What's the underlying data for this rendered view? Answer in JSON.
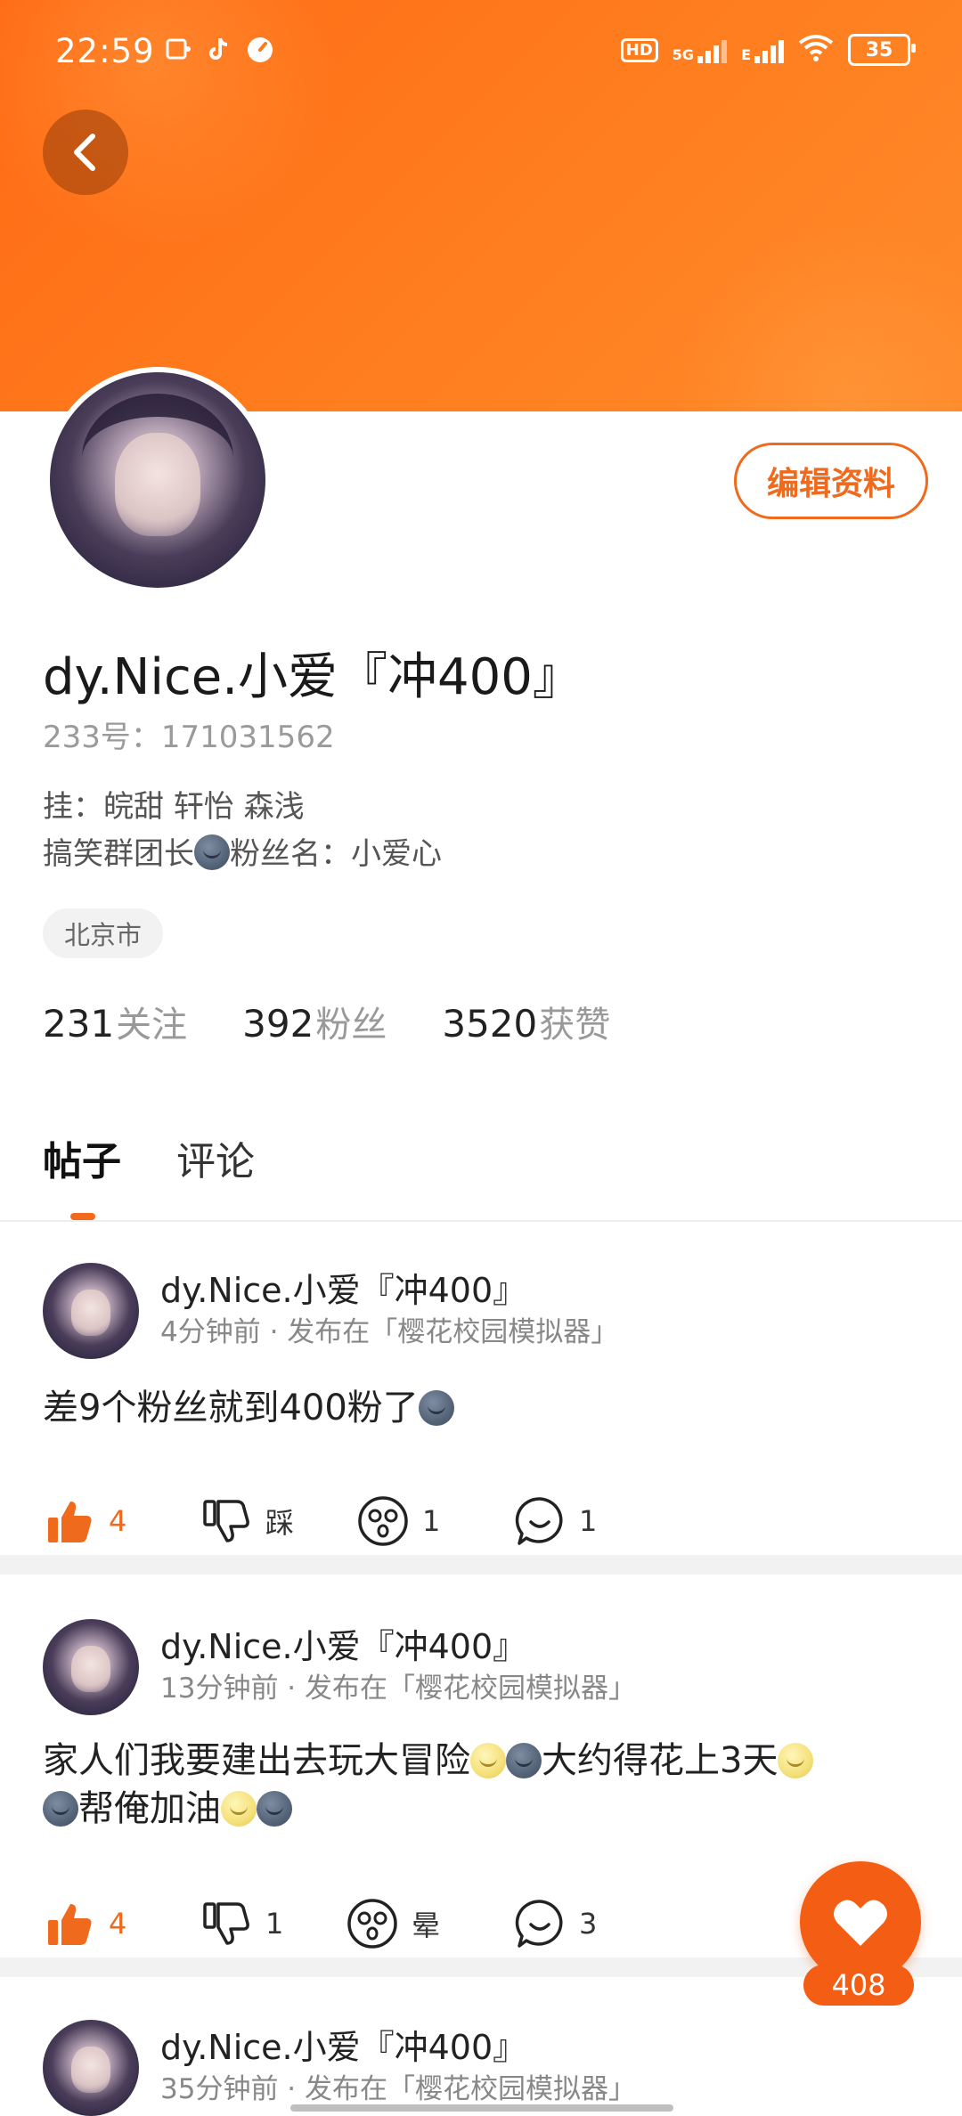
{
  "status_bar": {
    "time": "22:59",
    "left_icons": [
      "gallery-icon",
      "tiktok-icon",
      "speedometer-icon"
    ],
    "network_hd": "HD",
    "network_5g": "5G",
    "network_e": "E",
    "battery": "35"
  },
  "profile": {
    "nickname": "dy.Nice.小爱『冲400』",
    "uid": "233号：171031562",
    "bio_line1": "挂：皖甜 轩怡 森浅",
    "bio_line2_prefix": "搞笑群团长",
    "bio_line2_suffix": "粉丝名：小爱心",
    "location": "北京市",
    "edit_label": "编辑资料",
    "stats": [
      {
        "num": "231",
        "label": "关注"
      },
      {
        "num": "392",
        "label": "粉丝"
      },
      {
        "num": "3520",
        "label": "获赞"
      }
    ]
  },
  "tabs": [
    {
      "label": "帖子",
      "active": true
    },
    {
      "label": "评论",
      "active": false
    }
  ],
  "posts": [
    {
      "author": "dy.Nice.小爱『冲400』",
      "time": "4分钟前",
      "channel": "发布在「樱花校园模拟器」",
      "text_a": "差9个粉丝就到400粉了",
      "likes": "4",
      "dislike": "踩",
      "dizzy": "1",
      "comments": "1"
    },
    {
      "author": "dy.Nice.小爱『冲400』",
      "time": "13分钟前",
      "channel": "发布在「樱花校园模拟器」",
      "text_a": "家人们我要建出去玩大冒险",
      "text_b": "大约得花上3天",
      "text_c": "帮俺加油",
      "likes": "4",
      "dislike": "1",
      "dizzy": "晕",
      "comments": "3"
    },
    {
      "author": "dy.Nice.小爱『冲400』",
      "time": "35分钟前",
      "channel": "发布在「樱花校园模拟器」"
    }
  ],
  "fab": {
    "count": "408"
  },
  "colors": {
    "accent": "#f06a1e",
    "banner": "#ff7a1a"
  }
}
